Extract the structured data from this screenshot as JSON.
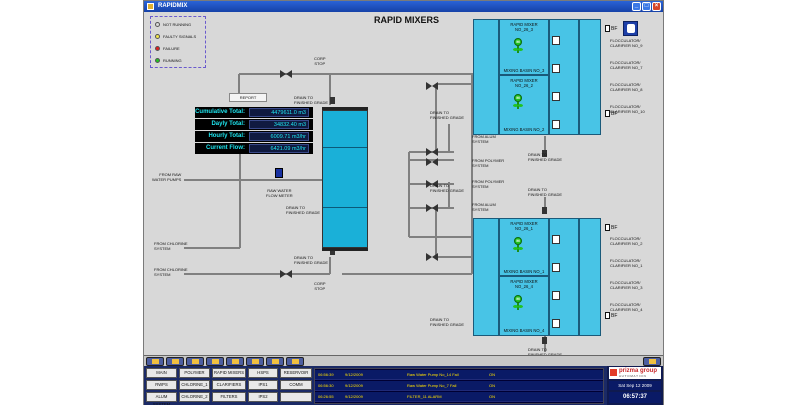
{
  "window": {
    "title": "RAPIDMIX"
  },
  "header": {
    "title": "RAPID MIXERS"
  },
  "legend": [
    {
      "label": "NOT RUNNING",
      "color": "#d9d9d9"
    },
    {
      "label": "FAULTY SIGNALS",
      "color": "#f2e64c"
    },
    {
      "label": "FAILURE",
      "color": "#e02020"
    },
    {
      "label": "RUNNING",
      "color": "#22c322"
    }
  ],
  "report_button": "REPORT",
  "stats": [
    {
      "label": "Cumulative Total:",
      "value": "4479611.0    m3"
    },
    {
      "label": "Dayly Total:",
      "value": "34832.40 m3"
    },
    {
      "label": "Hourly Total:",
      "value": "6009.71 m3/hr"
    },
    {
      "label": "Current Flow:",
      "value": "6421.09 m3/hr"
    }
  ],
  "labels": {
    "corp_stop_top": "CORP\nSTOP",
    "corp_stop_bottom": "CORP\nSTOP",
    "drain_top": "DRAIN TO\nFINISHED GRADE",
    "drain_mid_left": "DRAIN TO\nFINISHED GRADE",
    "drain_bottom_left": "DRAIN TO\nFINISHED GRADE",
    "drain_right_1": "DRAIN TO\nFINISHED GRADE",
    "drain_right_2": "DRAIN TO\nFINISHED GRADE",
    "drain_right_3": "DRAIN TO\nFINISHED GRADE",
    "drain_right_4": "DRAIN TO\nFINISHED GRADE",
    "drain_right_5": "DRAIN TO\nFINISHED GRADE",
    "from_raw_water": "FROM RAW\nWATER PUMPS",
    "raw_water_meter": "RAW WATER\nFLOW METER",
    "from_chlorine_1": "FROM CHLORINE\nSYSTEM",
    "from_chlorine_2": "FROM CHLORINE\nSYSTEM",
    "from_alum_1": "FROM ALUM\nSYSTEM",
    "from_polymer_1": "FROM POLYMER\nSYSTEM",
    "from_polymer_2": "FROM POLYMER\nSYSTEM",
    "from_alum_2": "FROM ALUM\nSYSTEM"
  },
  "basins": [
    {
      "mixer": "RAPID MIXER\nNO_26_3",
      "basin": "MIXING BASIN NO_3"
    },
    {
      "mixer": "RAPID MIXER\nNO_26_2",
      "basin": "MIXING BASIN NO_2"
    },
    {
      "mixer": "RAPID MIXER\nNO_26_1",
      "basin": "MIXING BASIN NO_1"
    },
    {
      "mixer": "RAPID MIXER\nNO_26_4",
      "basin": "MIXING BASIN NO_4"
    }
  ],
  "bf_label": "BF",
  "clarifiers_top": [
    "FLOCCULATOR/\nCLARIFIER NO_9",
    "FLOCCULATOR/\nCLARIFIER NO_7",
    "FLOCCULATOR/\nCLARIFIER NO_8",
    "FLOCCULATOR/\nCLARIFIER NO_10"
  ],
  "clarifiers_bottom": [
    "FLOCCULATOR/\nCLARIFIER NO_2",
    "FLOCCULATOR/\nCLARIFIER NO_1",
    "FLOCCULATOR/\nCLARIFIER NO_3",
    "FLOCCULATOR/\nCLARIFIER NO_4"
  ],
  "nav": [
    "MAIN",
    "POLYMER",
    "RAPID MIXERS",
    "HSPS",
    "RESERVOIR",
    "RWPS",
    "CHLORINE_1",
    "CLARIFIERS",
    "IPS1",
    "COMM",
    "ALUM SYSTEM",
    "CHLORINE_2",
    "FILTERS",
    "IPS2",
    ""
  ],
  "alarms": [
    {
      "time": "06:56:39",
      "date": "9/12/2009",
      "text": "Raw Water Pump No_14 Fail",
      "state": "ON"
    },
    {
      "time": "06:56:30",
      "date": "9/12/2009",
      "text": "Raw Water Pump No_7 Fail",
      "state": "ON"
    },
    {
      "time": "06:26:55",
      "date": "9/12/2009",
      "text": "FILTER_11  ALARM",
      "state": "ON"
    }
  ],
  "brand": {
    "name": "prizma group",
    "sub": "A U T O M A T I O N",
    "date": "Sat Sep 12 2009",
    "time": "06:57:37"
  }
}
